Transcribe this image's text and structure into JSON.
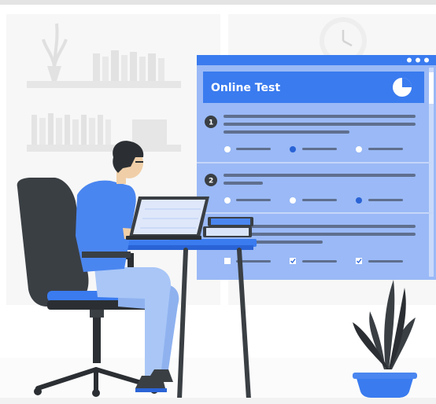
{
  "test_card": {
    "title": "Online Test",
    "question_numbers": [
      "1",
      "2"
    ]
  },
  "colors": {
    "accent": "#3a7bef",
    "accent_dark": "#2a63d6",
    "card": "#9ab9f6",
    "panel": "#b8cff8",
    "dark": "#3a3f44",
    "wall_gray": "#ececec",
    "shirt": "#4a86f0",
    "pants": "#a9c6f7"
  },
  "icons": {
    "pie": "pie-chart-icon",
    "clock": "clock-icon"
  }
}
